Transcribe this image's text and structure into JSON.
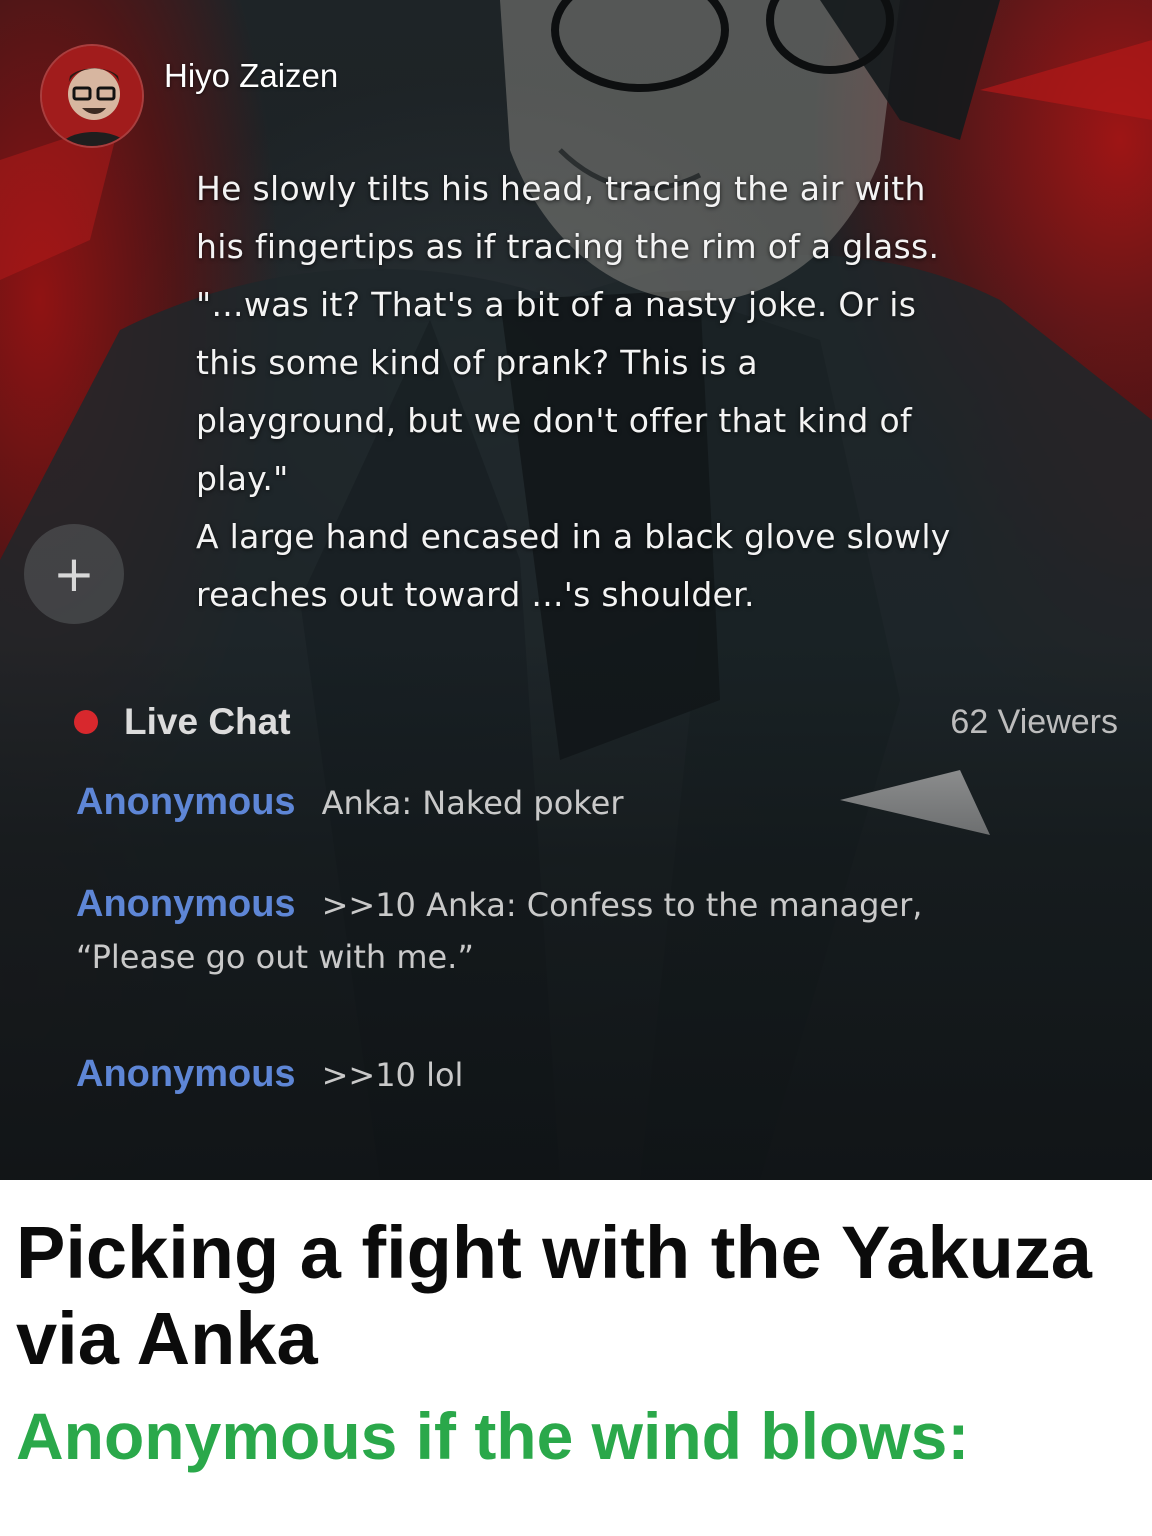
{
  "post": {
    "author": "Hiyo Zaizen",
    "paragraphs": [
      "He slowly tilts his head, tracing the air with his fingertips as if tracing the rim of a glass.",
      "\"...was it? That's a bit of a nasty joke. Or is this some kind of prank? This is a playground, but we don't offer that kind of play.\"",
      "A large hand encased in a black glove slowly reaches out toward ...'s shoulder."
    ]
  },
  "actions": {
    "add_symbol": "+"
  },
  "live_chat": {
    "label": "Live Chat",
    "viewers": "62 Viewers",
    "messages": [
      {
        "user": "Anonymous",
        "text": "Anka: Naked poker"
      },
      {
        "user": "Anonymous",
        "text": ">>10 Anka: Confess to the manager, “Please go out with me.”"
      },
      {
        "user": "Anonymous",
        "text": ">>10 lol"
      }
    ]
  },
  "title": {
    "headline": "Picking a fight with the Yakuza via Anka",
    "byline": "Anonymous if the wind blows:"
  },
  "colors": {
    "live_dot": "#d8282d",
    "username": "#5e86d6",
    "byline": "#2aa84a",
    "background_red": "#a81414"
  }
}
